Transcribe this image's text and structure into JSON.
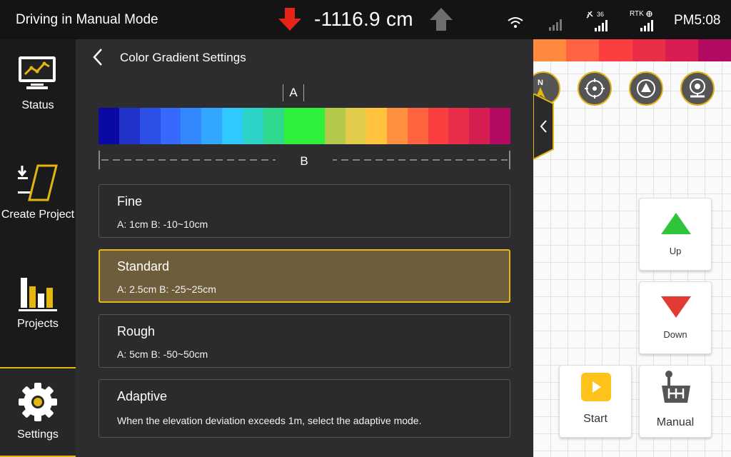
{
  "topbar": {
    "mode_title": "Driving in Manual Mode",
    "distance": "-1116.9 cm",
    "satellite_count": "36",
    "rtk_label": "RTK",
    "time": "PM5:08",
    "down_arrow_color": "#e8231a",
    "up_arrow_color": "#6e6e6e"
  },
  "sidebar": {
    "items": [
      {
        "label": "Status",
        "icon": "monitor-chart-icon"
      },
      {
        "label": "Create Project",
        "icon": "create-project-icon"
      },
      {
        "label": "Projects",
        "icon": "bar-chart-icon"
      },
      {
        "label": "Settings",
        "icon": "gear-icon",
        "active": true
      }
    ]
  },
  "panel": {
    "title": "Color Gradient Settings",
    "a_label": "A",
    "b_label": "B",
    "gradient_colors": [
      "#0a0aa3",
      "#1f33c9",
      "#2c4fe6",
      "#3769ff",
      "#3489ff",
      "#33a6ff",
      "#31c8ff",
      "#2cd3c9",
      "#2ed98e",
      "#2ef03a",
      "#2ef03a",
      "#b4c84a",
      "#e2cc49",
      "#ffc33d",
      "#ff9040",
      "#ff6340",
      "#fb3f41",
      "#e82e48",
      "#d51d51",
      "#b30a62"
    ],
    "options": [
      {
        "name": "Fine",
        "desc": "A: 1cm B: -10~10cm",
        "selected": false
      },
      {
        "name": "Standard",
        "desc": "A: 2.5cm B: -25~25cm",
        "selected": true
      },
      {
        "name": "Rough",
        "desc": "A: 5cm B: -50~50cm",
        "selected": false
      },
      {
        "name": "Adaptive",
        "desc": "When the elevation deviation exceeds 1m, select the adaptive mode.",
        "selected": false
      }
    ]
  },
  "map": {
    "scale_colors": [
      "#ff8a3d",
      "#ff6343",
      "#fb3f41",
      "#ea2e48",
      "#d71d52",
      "#b30a62"
    ],
    "north_label": "N",
    "up_label": "Up",
    "down_label": "Down",
    "start_label": "Start",
    "manual_label": "Manual",
    "up_color": "#2fc43a",
    "down_color": "#e23b33",
    "accent": "#e4b60f"
  }
}
